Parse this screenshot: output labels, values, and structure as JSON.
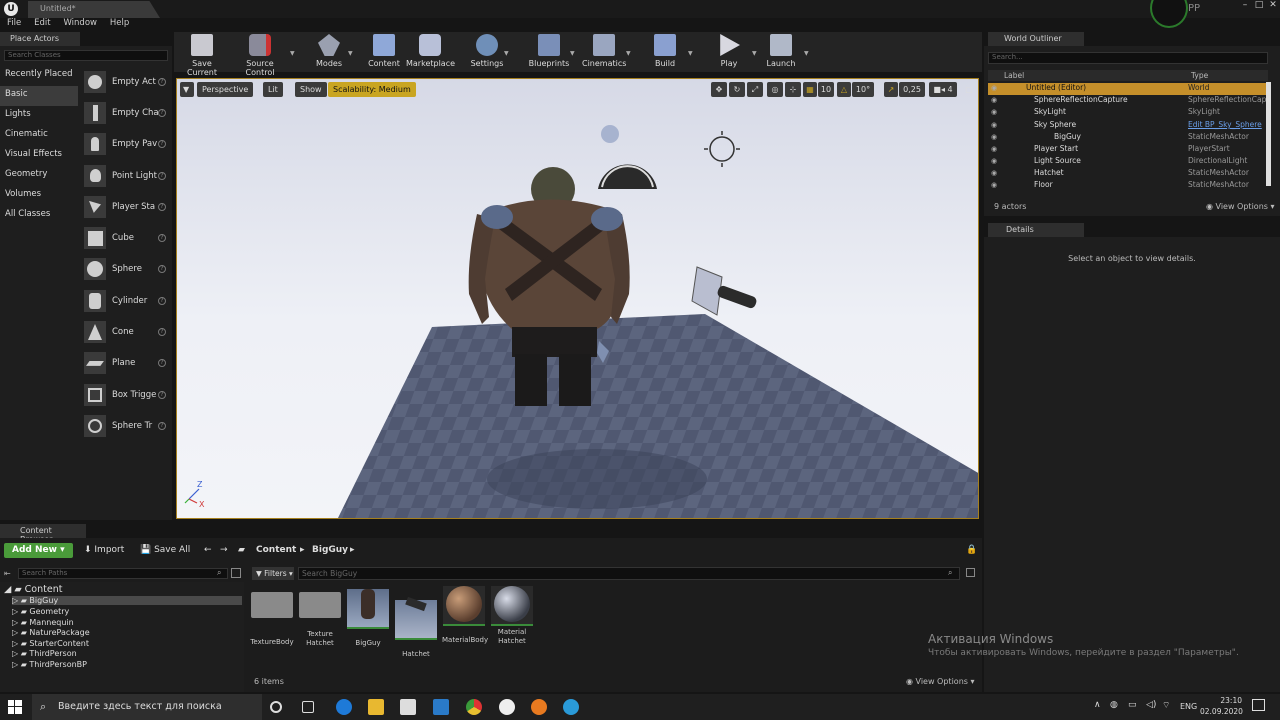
{
  "window": {
    "tab_title": "Untitled*",
    "user": "PP"
  },
  "menu": [
    "File",
    "Edit",
    "Window",
    "Help"
  ],
  "place_actors": {
    "tab": "Place Actors",
    "search_placeholder": "Search Classes",
    "categories": [
      "Recently Placed",
      "Basic",
      "Lights",
      "Cinematic",
      "Visual Effects",
      "Geometry",
      "Volumes",
      "All Classes"
    ],
    "items": [
      "Empty Act",
      "Empty Cha",
      "Empty Pav",
      "Point Light",
      "Player Sta",
      "Cube",
      "Sphere",
      "Cylinder",
      "Cone",
      "Plane",
      "Box Trigge",
      "Sphere Tr"
    ]
  },
  "toolbar": [
    "Save Current",
    "Source Control",
    "Modes",
    "Content",
    "Marketplace",
    "Settings",
    "Blueprints",
    "Cinematics",
    "Build",
    "Play",
    "Launch"
  ],
  "viewport": {
    "perspective": "Perspective",
    "lit": "Lit",
    "show": "Show",
    "scalability": "Scalability: Medium",
    "grid": "10",
    "rotation": "10°",
    "scale": "0,25",
    "cam_speed": "4"
  },
  "outliner": {
    "tab": "World Outliner",
    "search_placeholder": "Search...",
    "col_label": "Label",
    "col_type": "Type",
    "rows": [
      {
        "label": "Untitled (Editor)",
        "type": "World"
      },
      {
        "label": "SphereReflectionCapture",
        "type": "SphereReflectionCap"
      },
      {
        "label": "SkyLight",
        "type": "SkyLight"
      },
      {
        "label": "Sky Sphere",
        "type": "Edit BP_Sky_Sphere"
      },
      {
        "label": "BigGuy",
        "type": "StaticMeshActor"
      },
      {
        "label": "Player Start",
        "type": "PlayerStart"
      },
      {
        "label": "Light Source",
        "type": "DirectionalLight"
      },
      {
        "label": "Hatchet",
        "type": "StaticMeshActor"
      },
      {
        "label": "Floor",
        "type": "StaticMeshActor"
      }
    ],
    "count": "9 actors",
    "view_options": "View Options"
  },
  "details": {
    "tab": "Details",
    "message": "Select an object to view details."
  },
  "content_browser": {
    "tab": "Content Browser",
    "add_new": "Add New",
    "import": "Import",
    "save_all": "Save All",
    "path": [
      "Content",
      "BigGuy"
    ],
    "search_paths": "Search Paths",
    "filters": "Filters",
    "search_placeholder": "Search BigGuy",
    "tree_root": "Content",
    "tree": [
      "BigGuy",
      "Geometry",
      "Mannequin",
      "NaturePackage",
      "StarterContent",
      "ThirdPerson",
      "ThirdPersonBP"
    ],
    "assets": [
      "TextureBody",
      "Texture Hatchet",
      "BigGuy",
      "Hatchet",
      "MaterialBody",
      "Material Hatchet"
    ],
    "count": "6 items",
    "view_options": "View Options"
  },
  "watermark": {
    "title": "Активация Windows",
    "text": "Чтобы активировать Windows, перейдите в раздел \"Параметры\"."
  },
  "taskbar": {
    "search": "Введите здесь текст для поиска",
    "lang": "ENG",
    "time": "23:10",
    "date": "02.09.2020"
  },
  "colors": {
    "accent": "#c58f2a",
    "addnew": "#4a9b3a",
    "scalability": "#c9a521"
  }
}
